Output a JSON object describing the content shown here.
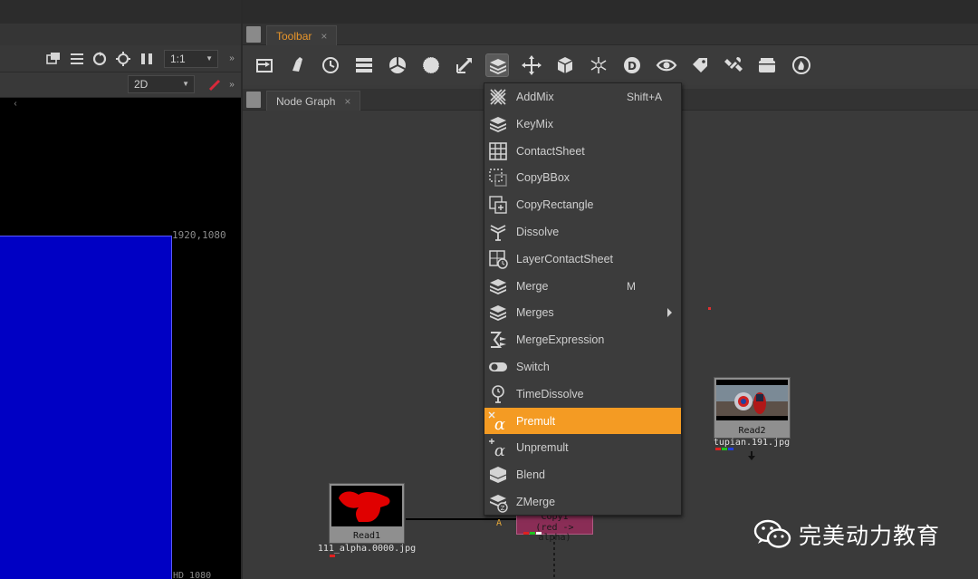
{
  "viewer": {
    "zoom": "1:1",
    "view_mode": "2D",
    "corner_label": "1920,1080",
    "format_label": "HD_1080"
  },
  "toolbar_panel": {
    "tab_label": "Toolbar",
    "close_glyph": "×",
    "tools": [
      {
        "name": "image-tool-icon"
      },
      {
        "name": "draw-tool-icon"
      },
      {
        "name": "time-tool-icon"
      },
      {
        "name": "channel-tool-icon"
      },
      {
        "name": "color-tool-icon"
      },
      {
        "name": "filter-tool-icon"
      },
      {
        "name": "keyer-tool-icon"
      },
      {
        "name": "merge-tool-icon"
      },
      {
        "name": "transform-tool-icon"
      },
      {
        "name": "3d-tool-icon"
      },
      {
        "name": "particles-tool-icon"
      },
      {
        "name": "deep-tool-icon"
      },
      {
        "name": "views-tool-icon"
      },
      {
        "name": "metadata-tool-icon"
      },
      {
        "name": "other-tool-icon"
      },
      {
        "name": "furnace-tool-icon"
      },
      {
        "name": "ofx-tool-icon"
      }
    ],
    "active_tool_index": 7
  },
  "nodegraph_panel": {
    "tab_label": "Node Graph",
    "close_glyph": "×"
  },
  "menu": {
    "items": [
      {
        "label": "AddMix",
        "shortcut": "Shift+A",
        "icon": "addmix-icon"
      },
      {
        "label": "KeyMix",
        "shortcut": "",
        "icon": "keymix-icon"
      },
      {
        "label": "ContactSheet",
        "shortcut": "",
        "icon": "contactsheet-icon"
      },
      {
        "label": "CopyBBox",
        "shortcut": "",
        "icon": "copybbox-icon"
      },
      {
        "label": "CopyRectangle",
        "shortcut": "",
        "icon": "copyrectangle-icon"
      },
      {
        "label": "Dissolve",
        "shortcut": "",
        "icon": "dissolve-icon"
      },
      {
        "label": "LayerContactSheet",
        "shortcut": "",
        "icon": "layercontactsheet-icon"
      },
      {
        "label": "Merge",
        "shortcut": "M",
        "icon": "merge-icon"
      },
      {
        "label": "Merges",
        "shortcut": "",
        "icon": "merges-icon",
        "submenu": true
      },
      {
        "label": "MergeExpression",
        "shortcut": "",
        "icon": "mergeexpression-icon"
      },
      {
        "label": "Switch",
        "shortcut": "",
        "icon": "switch-icon"
      },
      {
        "label": "TimeDissolve",
        "shortcut": "",
        "icon": "timedissolve-icon"
      },
      {
        "label": "Premult",
        "shortcut": "",
        "icon": "premult-icon",
        "highlighted": true
      },
      {
        "label": "Unpremult",
        "shortcut": "",
        "icon": "unpremult-icon"
      },
      {
        "label": "Blend",
        "shortcut": "",
        "icon": "blend-icon"
      },
      {
        "label": "ZMerge",
        "shortcut": "",
        "icon": "zmerge-icon"
      }
    ],
    "highlight_color": "#f49b23"
  },
  "nodes": {
    "read1": {
      "label": "Read1",
      "file": "111_alpha.0000.jpg"
    },
    "read2": {
      "label": "Read2",
      "file": "tupian.191.jpg"
    },
    "copy1": {
      "label": "Copy1",
      "detail": "(red -> alpha)",
      "input_label": "A",
      "color": "#8a2d56"
    }
  },
  "watermark": {
    "text": "完美动力教育"
  }
}
